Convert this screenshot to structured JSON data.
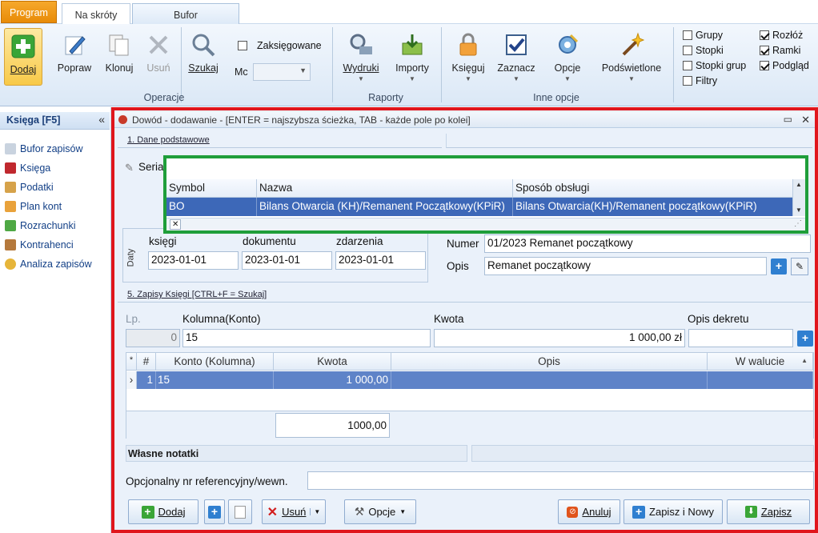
{
  "tabs": {
    "program": "Program",
    "na_skroty": "Na skróty",
    "bufor": "Bufor"
  },
  "ribbon": {
    "dodaj": "Dodaj",
    "popraw": "Popraw",
    "klonuj": "Klonuj",
    "usun": "Usuń",
    "szukaj": "Szukaj",
    "zaksiegowane": "Zaksięgowane",
    "mc_label": "Mc",
    "mc_value": "",
    "operacje": "Operacje",
    "wydruki": "Wydruki",
    "importy": "Importy",
    "raporty": "Raporty",
    "ksieguj": "Księguj",
    "zaznacz": "Zaznacz",
    "opcje": "Opcje",
    "inne_opcje": "Inne opcje",
    "podswietlone": "Podświetlone",
    "checks": {
      "grupy": "Grupy",
      "stopki": "Stopki",
      "stopki_grup": "Stopki grup",
      "filtry": "Filtry",
      "rozloz": "Rozłóż",
      "ramki": "Ramki",
      "podglad": "Podgląd"
    }
  },
  "sidebar": {
    "header": "Księga [F5]",
    "collapse": "«",
    "items": [
      "Bufor zapisów",
      "Księga",
      "Podatki",
      "Plan kont",
      "Rozrachunki",
      "Kontrahenci",
      "Analiza zapisów"
    ]
  },
  "window": {
    "title": "Dowód - dodawanie - [ENTER = najszybsza ścieżka, TAB - każde pole po kolei]",
    "min": "▭",
    "close": "✕"
  },
  "form": {
    "section1": "1. Dane podstawowe",
    "seria_label": "Seria",
    "seria_value": "BO",
    "daty_label": "Daty",
    "ksiegi_label": "księgi",
    "ksiegi_value": "2023-01-01",
    "dokumentu_label": "dokumentu",
    "dokumentu_value": "2023-01-01",
    "zdarzenia_label": "zdarzenia",
    "zdarzenia_value": "2023-01-01",
    "numer_label": "Numer",
    "numer_value": "01/2023 Remanet początkowy",
    "opis_label": "Opis",
    "opis_value": "Remanet początkowy"
  },
  "dropdown": {
    "headers": [
      "Symbol",
      "Nazwa",
      "Sposób obsługi"
    ],
    "row": [
      "BO",
      "Bilans Otwarcia (KH)/Remanent Początkowy(KPiR)",
      "Bilans Otwarcia(KH)/Remanent początkowy(KPiR)"
    ],
    "close": "✕"
  },
  "zapisy": {
    "section5": "5. Zapisy Księgi [CTRL+F = Szukaj]",
    "lp_label": "Lp.",
    "lp_value": "0",
    "kolumna_label": "Kolumna(Konto)",
    "kolumna_value": "15",
    "kwota_label": "Kwota",
    "kwota_value": "1 000,00 zł",
    "opis_dekretu_label": "Opis dekretu",
    "opis_dekretu_value": "",
    "grid_headers": [
      "*",
      "#",
      "Konto (Kolumna)",
      "Kwota",
      "Opis",
      "W walucie"
    ],
    "grid_row": {
      "marker": "›",
      "num": "1",
      "konto": "15",
      "kwota": "1 000,00",
      "opis": "",
      "waluta": ""
    },
    "total": "1000,00",
    "notatki": "Własne notatki",
    "ref_label": "Opcjonalny nr referencyjny/wewn.",
    "ref_value": ""
  },
  "bottom": {
    "dodaj": "Dodaj",
    "usun": "Usuń",
    "opcje": "Opcje",
    "anuluj": "Anuluj",
    "zapisz_nowy": "Zapisz i Nowy",
    "zapisz": "Zapisz"
  },
  "colors": {
    "accent_red": "#e0161c",
    "accent_green": "#1f9e3a",
    "selection": "#3d68b8",
    "seria_bg": "#fff86a"
  }
}
